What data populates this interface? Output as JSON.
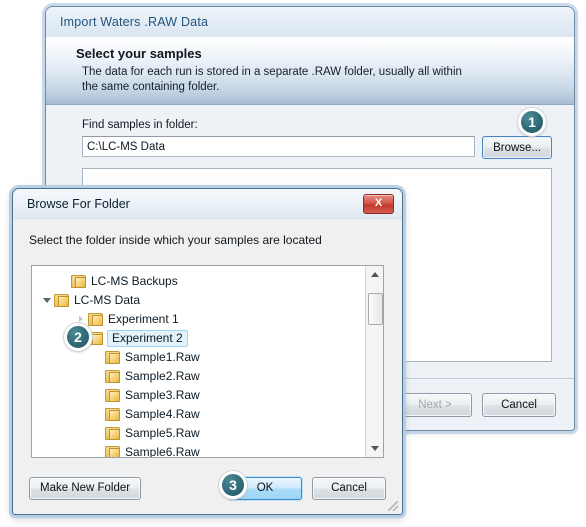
{
  "wizard": {
    "title": "Import Waters .RAW Data",
    "header_title": "Select your samples",
    "header_sub_line1": "The data for each run is stored in a separate .RAW folder, usually all within",
    "header_sub_line2": "the same containing folder.",
    "field_label": "Find samples in folder:",
    "path_value": "C:\\LC-MS Data",
    "browse_label": "Browse...",
    "next_label": "Next >",
    "cancel_label": "Cancel"
  },
  "browse_dialog": {
    "title": "Browse For Folder",
    "close_glyph": "X",
    "prompt": "Select the folder inside which your samples are located",
    "tree": [
      {
        "label": "LC-MS Backups",
        "indent": 1,
        "expander": "none",
        "selected": false
      },
      {
        "label": "LC-MS Data",
        "indent": 0,
        "expander": "open",
        "selected": false
      },
      {
        "label": "Experiment 1",
        "indent": 2,
        "expander": "hollow",
        "selected": false
      },
      {
        "label": "Experiment 2",
        "indent": 2,
        "expander": "none",
        "selected": true
      },
      {
        "label": "Sample1.Raw",
        "indent": 3,
        "expander": "none",
        "selected": false
      },
      {
        "label": "Sample2.Raw",
        "indent": 3,
        "expander": "none",
        "selected": false
      },
      {
        "label": "Sample3.Raw",
        "indent": 3,
        "expander": "none",
        "selected": false
      },
      {
        "label": "Sample4.Raw",
        "indent": 3,
        "expander": "none",
        "selected": false
      },
      {
        "label": "Sample5.Raw",
        "indent": 3,
        "expander": "none",
        "selected": false
      },
      {
        "label": "Sample6.Raw",
        "indent": 3,
        "expander": "none",
        "selected": false
      },
      {
        "label": "",
        "indent": 3,
        "expander": "none",
        "selected": false
      }
    ],
    "make_new_folder_label": "Make New Folder",
    "ok_label": "OK",
    "cancel_label": "Cancel"
  },
  "callouts": [
    {
      "number": "1"
    },
    {
      "number": "2"
    },
    {
      "number": "3"
    }
  ],
  "colors": {
    "badge": "#2e6b78",
    "close_button": "#c2392d",
    "selection": "#e4f2fb",
    "folder": "#edc25e"
  }
}
